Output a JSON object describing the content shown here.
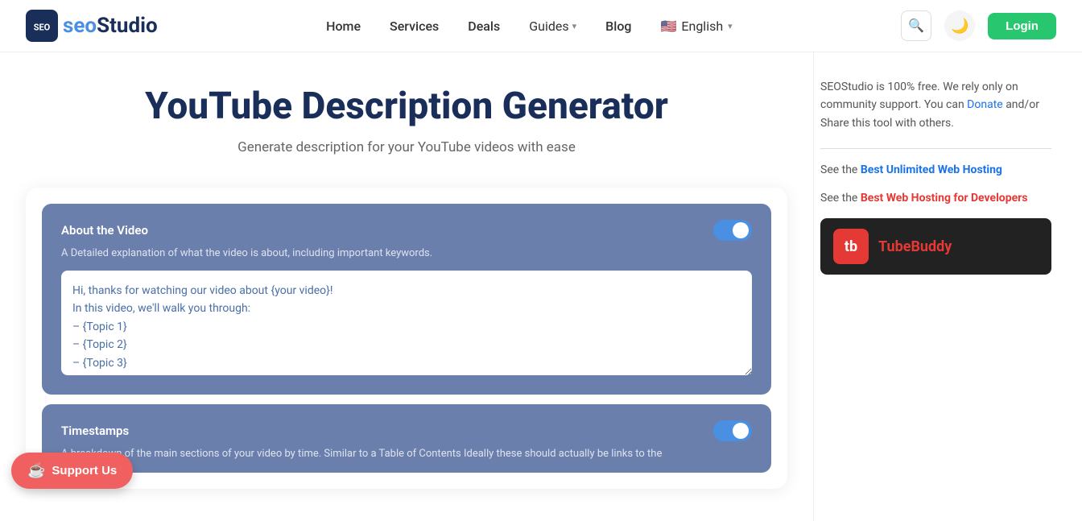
{
  "header": {
    "logo_text": "Studio",
    "logo_prefix": "seo",
    "nav": [
      {
        "label": "Home",
        "href": "#"
      },
      {
        "label": "Services",
        "href": "#"
      },
      {
        "label": "Deals",
        "href": "#"
      },
      {
        "label": "Guides",
        "href": "#",
        "has_dropdown": true
      },
      {
        "label": "Blog",
        "href": "#"
      }
    ],
    "language": "English",
    "login_label": "Login"
  },
  "page": {
    "title": "YouTube Description Generator",
    "subtitle": "Generate description for your YouTube videos with ease"
  },
  "sections": [
    {
      "id": "about-video",
      "title": "About the Video",
      "desc": "A Detailed explanation of what the video is about, including important keywords.",
      "default_text": "Hi, thanks for watching our video about {your video}!\nIn this video, we'll walk you through:\n– {Topic 1}\n– {Topic 2}\n– {Topic 3}",
      "enabled": true
    },
    {
      "id": "timestamps",
      "title": "Timestamps",
      "desc": "A breakdown of the main sections of your video by time. Similar to a Table of Contents Ideally these should actually be links to the",
      "default_text": "",
      "enabled": true
    }
  ],
  "sidebar": {
    "intro_text": "SEOStudio is 100% free. We rely only on community support. You can ",
    "donate_label": "Donate",
    "share_text": "and/or Share this tool with others.",
    "link1_prefix": "See the ",
    "link1_label": "Best Unlimited Web Hosting",
    "link2_prefix": "See the ",
    "link2_label": "Best Web Hosting for Developers",
    "tubebuddy_text": "Tube",
    "tubebuddy_colored": "Buddy",
    "tubebuddy_logo": "tb"
  },
  "support": {
    "label": "Support Us",
    "icon": "☕"
  }
}
